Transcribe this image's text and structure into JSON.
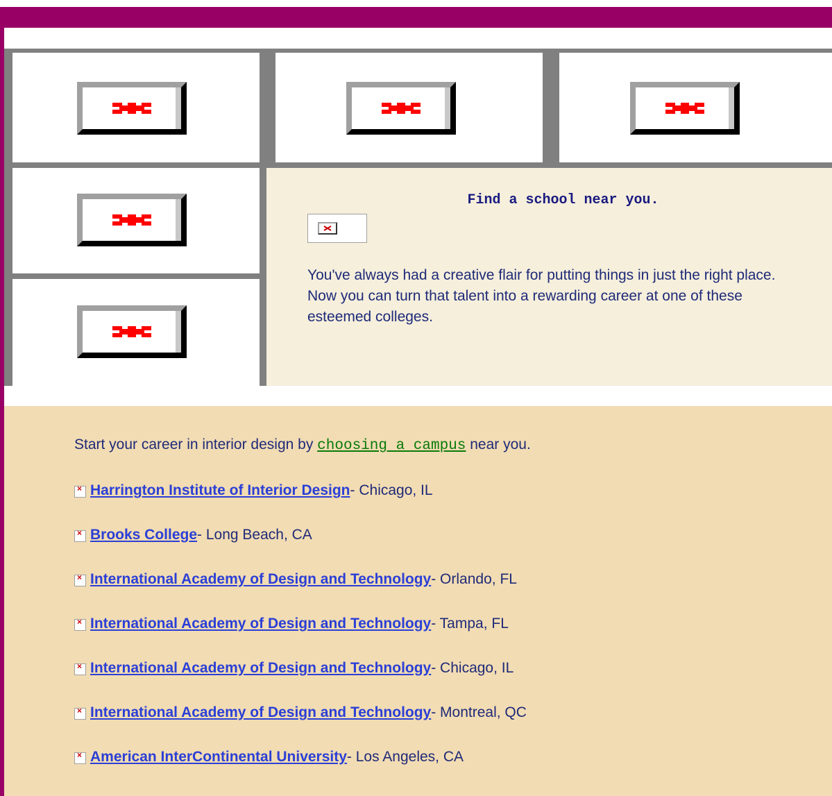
{
  "colors": {
    "header": "#990066",
    "promo_bg": "#f5efdc",
    "lower_bg": "#f2dcb3",
    "link": "#2b3fd6",
    "text": "#1f2a78"
  },
  "images": [
    "broken-image-icon",
    "broken-image-icon",
    "broken-image-icon",
    "broken-image-icon",
    "broken-image-icon"
  ],
  "promo": {
    "title": "Find a school near you.",
    "text": "You've always had a creative flair for putting things in just the right place. Now you can turn that talent into a rewarding career at one of these esteemed colleges."
  },
  "intro": {
    "before": "Start your career in interior design by ",
    "link": "choosing a campus",
    "after": " near you."
  },
  "schools": [
    {
      "name": "Harrington Institute of Interior Design",
      "location": " - Chicago, IL"
    },
    {
      "name": "Brooks College",
      "location": " - Long Beach, CA"
    },
    {
      "name": " International Academy of Design and Technology",
      "location": " - Orlando, FL"
    },
    {
      "name": "International Academy of Design and Technology",
      "location": " - Tampa, FL"
    },
    {
      "name": "International Academy of Design and Technology",
      "location": " - Chicago, IL"
    },
    {
      "name": "International Academy of Design and Technology",
      "location": " - Montreal, QC"
    },
    {
      "name": "American InterContinental University",
      "location": " - Los Angeles, CA"
    }
  ]
}
